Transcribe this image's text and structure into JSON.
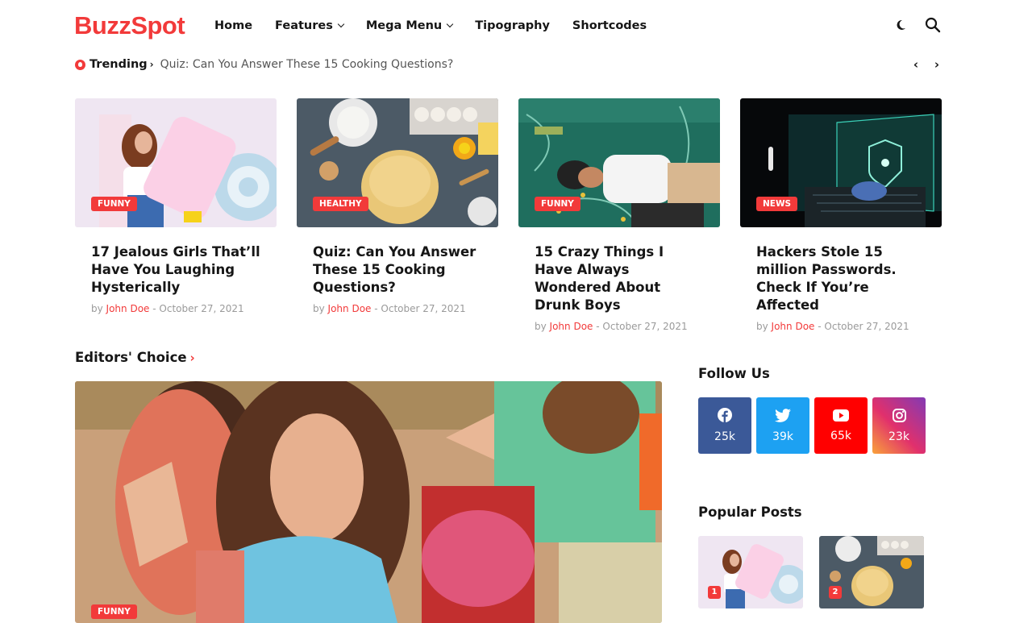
{
  "brand": {
    "logo": "BuzzSpot",
    "accent": "#f23a3a"
  },
  "nav": [
    {
      "label": "Home"
    },
    {
      "label": "Features"
    },
    {
      "label": "Mega Menu"
    },
    {
      "label": "Tipography"
    },
    {
      "label": "Shortcodes"
    }
  ],
  "header_icons": [
    "dark-mode-icon",
    "search-icon"
  ],
  "trending": {
    "label": "Trending",
    "headline": "Quiz: Can You Answer These 15 Cooking Questions?"
  },
  "cards": [
    {
      "tag": "FUNNY",
      "title": "17 Jealous Girls That’ll Have You Laughing Hysterically",
      "by": "by",
      "author": "John Doe",
      "date": "- October 27, 2021"
    },
    {
      "tag": "HEALTHY",
      "title": "Quiz: Can You Answer These 15 Cooking Questions?",
      "by": "by",
      "author": "John Doe",
      "date": "- October 27, 2021"
    },
    {
      "tag": "FUNNY",
      "title": "15 Crazy Things I Have Always Wondered About Drunk Boys",
      "by": "by",
      "author": "John Doe",
      "date": "- October 27, 2021"
    },
    {
      "tag": "NEWS",
      "title": "Hackers Stole 15 million Passwords. Check If You’re Affected",
      "by": "by",
      "author": "John Doe",
      "date": "- October 27, 2021"
    }
  ],
  "editors_choice": {
    "heading": "Editors' Choice",
    "tag": "FUNNY"
  },
  "follow": {
    "heading": "Follow Us",
    "items": [
      {
        "network": "facebook-icon",
        "count": "25k",
        "color": "#3b5998"
      },
      {
        "network": "twitter-icon",
        "count": "39k",
        "color": "#1da1f2"
      },
      {
        "network": "youtube-icon",
        "count": "65k",
        "color": "#ff0000"
      },
      {
        "network": "instagram-icon",
        "count": "23k",
        "color": "#c13584"
      }
    ]
  },
  "popular": {
    "heading": "Popular Posts",
    "items": [
      {
        "rank": "1"
      },
      {
        "rank": "2"
      }
    ]
  }
}
